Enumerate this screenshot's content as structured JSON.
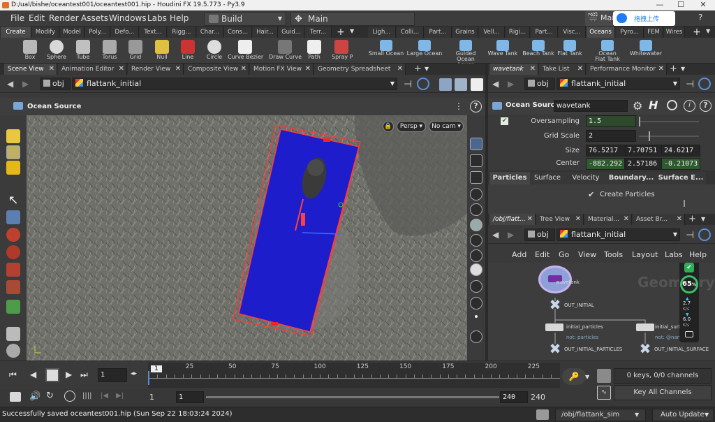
{
  "titlebar": {
    "title": "D:/ual/bishe/oceantest001/oceantest001.hip - Houdini FX 19.5.773 - Py3.9",
    "min": "—",
    "max": "☐",
    "close": "✕"
  },
  "menu": {
    "items": [
      "File",
      "Edit",
      "Render",
      "Assets",
      "Windows",
      "Labs",
      "Help"
    ],
    "desktop": "Build",
    "workspace": "Main",
    "upload": "拖拽上传",
    "maiLabel": "Mai"
  },
  "shelf_tabs_left": [
    "Create",
    "Modify",
    "Model",
    "Poly...",
    "Defo...",
    "Text...",
    "Rigg...",
    "Char...",
    "Cons...",
    "Hair...",
    "Guid...",
    "Terr..."
  ],
  "shelf_tabs_right": [
    "Ligh...",
    "Colli...",
    "Part...",
    "Grains",
    "Vell...",
    "Rigi...",
    "Part...",
    "Visc...",
    "Oceans",
    "Pyro...",
    "FEM",
    "Wires"
  ],
  "shelf_tools_left": [
    "Box",
    "Sphere",
    "Tube",
    "Torus",
    "Grid",
    "Null",
    "Line",
    "Circle",
    "Curve Bezier",
    "Draw Curve",
    "Path",
    "Spray P"
  ],
  "shelf_tools_right": [
    "Small Ocean",
    "Large Ocean",
    "Guided\nOcean Layer",
    "Wave Tank",
    "Beach Tank",
    "Flat Tank",
    "Ocean\nFlat Tank",
    "Whitewater"
  ],
  "left_panes": [
    "Scene View",
    "Animation Editor",
    "Render View",
    "Composite View",
    "Motion FX View",
    "Geometry Spreadsheet"
  ],
  "right_top_panes": [
    "wavetank",
    "Take List",
    "Performance Monitor"
  ],
  "right_bottom_panes": [
    "/obj/flatt...",
    "Tree View",
    "Material...",
    "Asset Br..."
  ],
  "viewport": {
    "path_root": "obj",
    "path_node": "flattank_initial",
    "header": "Ocean Source",
    "persp": "Persp",
    "cam": "No cam"
  },
  "params": {
    "path_root": "obj",
    "path_node": "flattank_initial",
    "node_type": "Ocean Source",
    "node_name": "wavetank",
    "oversampling_label": "Oversampling",
    "oversampling": "1.5",
    "gridscale_label": "Grid Scale",
    "gridscale": "2",
    "size_label": "Size",
    "size": [
      "76.5217",
      "7.70751",
      "24.6217"
    ],
    "center_label": "Center",
    "center": [
      "-882.292",
      "2.57186",
      "-0.21073"
    ],
    "tabs": [
      "Particles",
      "Surface",
      "Velocity",
      "Boundary...",
      "Surface E..."
    ],
    "create_particles": "Create Particles"
  },
  "network": {
    "path_root": "obj",
    "path_node": "flattank_initial",
    "menu": [
      "Add",
      "Edit",
      "Go",
      "View",
      "Tools",
      "Layout",
      "Labs",
      "Help"
    ],
    "watermark": "Geometry",
    "perf_value": "65",
    "perf_suffix": "%",
    "rate1": "2.7",
    "rate1_unit": "K/s",
    "rate2": "6.0",
    "rate2_unit": "K/s",
    "nodes": {
      "wavetank": "wavetank",
      "out_initial": "OUT_INITIAL",
      "initial_particles": "initial_particles",
      "initial_particles_sub": "not: particles",
      "initial_surface": "initial_surfac",
      "initial_surface_sub": "not: @name=su",
      "out_particles": "OUT_INITIAL_PARTICLES",
      "out_surface": "OUT_INITIAL_SURFACE"
    }
  },
  "timeline": {
    "frame": "1",
    "ticks": [
      "1",
      "25",
      "50",
      "75",
      "100",
      "125",
      "150",
      "175",
      "200",
      "225"
    ],
    "range_start": "1",
    "range_start2": "1",
    "range_end": "240",
    "range_end2": "240",
    "keys": "0 keys, 0/0 channels",
    "key_all": "Key All Channels"
  },
  "status": {
    "message": "Successfully saved oceantest001.hip (Sun Sep 22 18:03:24 2024)",
    "path": "/obj/flattank_sim",
    "auto_update": "Auto Update"
  }
}
